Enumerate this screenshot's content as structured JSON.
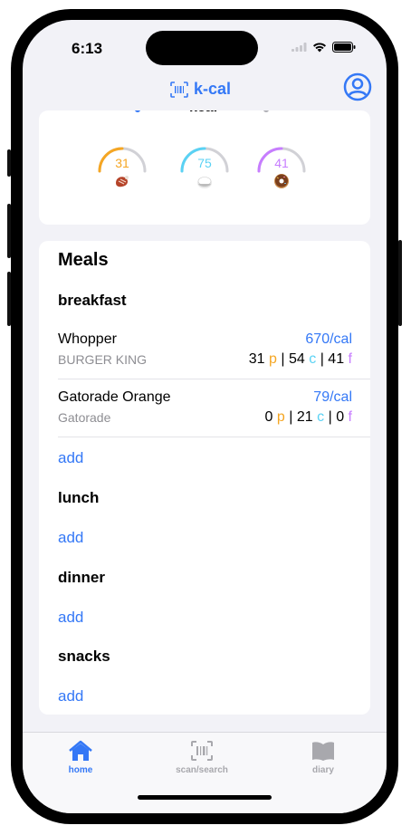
{
  "status": {
    "time": "6:13"
  },
  "nav": {
    "title": "k-cal"
  },
  "summary": {
    "partial_label": "kcal",
    "macros": [
      {
        "id": "protein",
        "value": "31",
        "color": "#f5a623",
        "progress": 0.5,
        "icon": "steak-icon"
      },
      {
        "id": "carbs",
        "value": "75",
        "color": "#5ad2f4",
        "progress": 0.5,
        "icon": "rice-icon"
      },
      {
        "id": "fat",
        "value": "41",
        "color": "#c77dff",
        "progress": 0.5,
        "icon": "donut-icon"
      }
    ]
  },
  "meals": {
    "title": "Meals",
    "add_label": "add",
    "sections": [
      {
        "name": "breakfast",
        "items": [
          {
            "name": "Whopper",
            "brand": "BURGER KING",
            "cal": "670/cal",
            "p": "31",
            "c": "54",
            "f": "41"
          },
          {
            "name": "Gatorade Orange",
            "brand": "Gatorade",
            "cal": "79/cal",
            "p": "0",
            "c": "21",
            "f": "0"
          }
        ]
      },
      {
        "name": "lunch",
        "items": []
      },
      {
        "name": "dinner",
        "items": []
      },
      {
        "name": "snacks",
        "items": []
      }
    ],
    "macro_letters": {
      "p": "p",
      "c": "c",
      "f": "f"
    },
    "macro_separator": "|"
  },
  "tabs": [
    {
      "label": "home",
      "icon": "house-icon",
      "active": true
    },
    {
      "label": "scan/search",
      "icon": "barcode-scan-icon",
      "active": false
    },
    {
      "label": "diary",
      "icon": "book-icon",
      "active": false
    }
  ],
  "colors": {
    "accent": "#3478f6",
    "protein": "#f5a623",
    "carbs": "#5ad2f4",
    "fat": "#c77dff"
  }
}
